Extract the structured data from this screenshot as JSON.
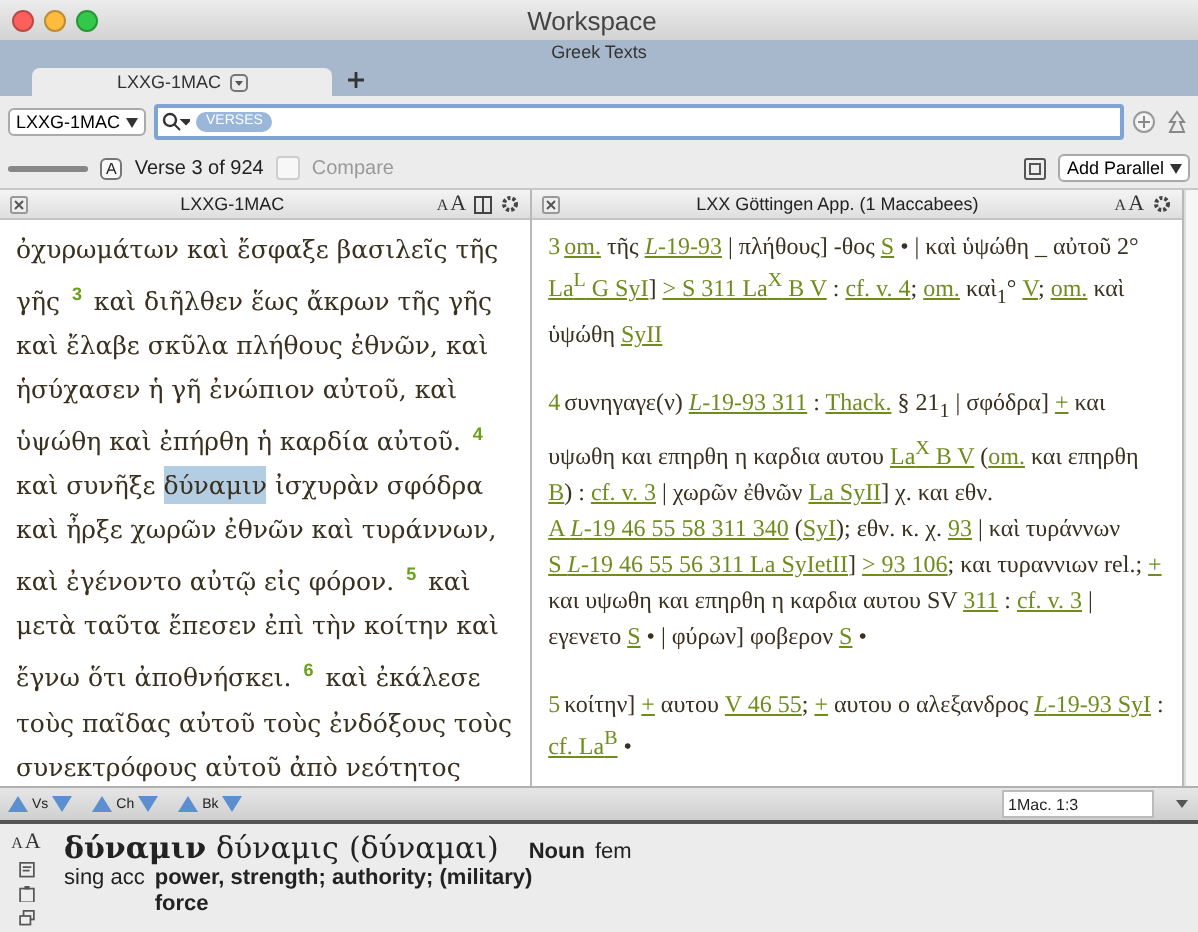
{
  "window": {
    "title": "Workspace",
    "subtitle": "Greek Texts"
  },
  "tabs": [
    {
      "label": "LXXG-1MAC",
      "selected": true
    }
  ],
  "toolbar": {
    "font_slider": {
      "level": 1,
      "knob": "A"
    },
    "module": "LXXG-1MAC",
    "search_chip": "VERSES",
    "verse_status": "Verse 3 of 924",
    "compare": {
      "label": "Compare",
      "checked": false,
      "disabled": true
    },
    "add_parallel": "Add Parallel"
  },
  "left_pane": {
    "title": "LXXG-1MAC",
    "font_buttons": [
      "A",
      "A"
    ],
    "text": [
      {
        "kind": "text",
        "t": "ὀχυρωμάτων καὶ ἔσφαξε βασιλεῖς τῆς γῆς "
      },
      {
        "kind": "verse",
        "t": "3"
      },
      {
        "kind": "text",
        "t": " καὶ διῆλθεν ἕως ἄκρων τῆς γῆς καὶ ἔλαβε σκῦλα πλήθους ἐθνῶν, καὶ ἡσύχασεν ἡ γῆ ἐνώπιον αὐτοῦ, καὶ ὑψώθη καὶ ἐπήρθη ἡ καρδία αὐτοῦ. "
      },
      {
        "kind": "verse",
        "t": "4"
      },
      {
        "kind": "text",
        "t": " καὶ συνῆξε "
      },
      {
        "kind": "highlight",
        "t": "δύναμιν"
      },
      {
        "kind": "text",
        "t": " ἰσχυρὰν σφόδρα καὶ ἦρξε χωρῶν ἐθνῶν καὶ τυράννων, καὶ ἐγένοντο αὐτῷ εἰς φόρον. "
      },
      {
        "kind": "verse",
        "t": "5"
      },
      {
        "kind": "text",
        "t": " καὶ μετὰ ταῦτα ἔπεσεν ἐπὶ τὴν κοίτην καὶ ἔγνω ὅτι ἀποθνήσκει. "
      },
      {
        "kind": "verse",
        "t": "6"
      },
      {
        "kind": "text",
        "t": " καὶ ἐκάλεσε τοὺς παῖδας αὐτοῦ τοὺς ἐνδόξους τοὺς συνεκτρόφους αὐτοῦ ἀπὸ νεότητος"
      }
    ]
  },
  "right_pane": {
    "title": "LXX Göttingen App. (1 Maccabees)",
    "font_buttons": [
      "A",
      "A"
    ],
    "paragraphs": [
      [
        {
          "kind": "verse",
          "t": "3"
        },
        {
          "kind": "link",
          "t": "om."
        },
        {
          "kind": "text",
          "t": " τῆς "
        },
        {
          "kind": "link",
          "t": "*L*-19-93"
        },
        {
          "kind": "text",
          "t": " | πλήθους] -θος "
        },
        {
          "kind": "link",
          "t": "S"
        },
        {
          "kind": "text",
          "t": " • | καὶ ὑψώθη _ αὐτοῦ 2° "
        },
        {
          "kind": "link",
          "t": "La$^{L}$ G SyI"
        },
        {
          "kind": "text",
          "t": "] "
        },
        {
          "kind": "link",
          "t": "> S 311 La$^{X}$ B V"
        },
        {
          "kind": "text",
          "t": " : "
        },
        {
          "kind": "link",
          "t": "cf. v. 4"
        },
        {
          "kind": "text",
          "t": "; "
        },
        {
          "kind": "link",
          "t": "om."
        },
        {
          "kind": "text",
          "t": " καὶ$_{1}$° "
        },
        {
          "kind": "link",
          "t": "V"
        },
        {
          "kind": "text",
          "t": "; "
        },
        {
          "kind": "link",
          "t": "om."
        },
        {
          "kind": "text",
          "t": " καὶ ὑψώθη "
        },
        {
          "kind": "link",
          "t": "SyII"
        }
      ],
      [
        {
          "kind": "verse",
          "t": "4"
        },
        {
          "kind": "text",
          "t": "συνηγαγε(ν) "
        },
        {
          "kind": "link",
          "t": "*L*-19-93 311"
        },
        {
          "kind": "text",
          "t": " : "
        },
        {
          "kind": "link",
          "t": "Thack."
        },
        {
          "kind": "text",
          "t": " § 21$_{1}$ | σφόδρα] "
        },
        {
          "kind": "link",
          "t": "+"
        },
        {
          "kind": "text",
          "t": " και υψωθη και επηρθη η καρδια αυτου "
        },
        {
          "kind": "link",
          "t": "La$^{X}$ B V"
        },
        {
          "kind": "text",
          "t": " ("
        },
        {
          "kind": "link",
          "t": "om."
        },
        {
          "kind": "text",
          "t": " και επηρθη "
        },
        {
          "kind": "link",
          "t": "B"
        },
        {
          "kind": "text",
          "t": ") : "
        },
        {
          "kind": "link",
          "t": "cf. v. 3"
        },
        {
          "kind": "text",
          "t": " | χωρῶν ἐθνῶν "
        },
        {
          "kind": "link",
          "t": "La SyII"
        },
        {
          "kind": "text",
          "t": "] χ. και εθν. "
        },
        {
          "kind": "link",
          "t": "A *L*-19 46 55 58 311 340"
        },
        {
          "kind": "text",
          "t": " ("
        },
        {
          "kind": "link",
          "t": "SyI"
        },
        {
          "kind": "text",
          "t": "); εθν. κ. χ. "
        },
        {
          "kind": "link",
          "t": "93"
        },
        {
          "kind": "text",
          "t": " | καὶ τυράννων "
        },
        {
          "kind": "link",
          "t": "S *L*-19 46 55 56 311 La SyIetII"
        },
        {
          "kind": "text",
          "t": "] "
        },
        {
          "kind": "link",
          "t": "> 93 106"
        },
        {
          "kind": "text",
          "t": "; και τυραννιων rel.; "
        },
        {
          "kind": "link",
          "t": "+"
        },
        {
          "kind": "text",
          "t": " και υψωθη και επηρθη η καρδια αυτου SV "
        },
        {
          "kind": "link",
          "t": "311"
        },
        {
          "kind": "text",
          "t": " : "
        },
        {
          "kind": "link",
          "t": "cf. v. 3"
        },
        {
          "kind": "text",
          "t": " | εγενετο "
        },
        {
          "kind": "link",
          "t": "S"
        },
        {
          "kind": "text",
          "t": " • | φύρων] φοβερον "
        },
        {
          "kind": "link",
          "t": "S"
        },
        {
          "kind": "text",
          "t": " •"
        }
      ],
      [
        {
          "kind": "verse",
          "t": "5"
        },
        {
          "kind": "text",
          "t": "κοίτην] "
        },
        {
          "kind": "link",
          "t": "+"
        },
        {
          "kind": "text",
          "t": " αυτου "
        },
        {
          "kind": "link",
          "t": "V 46 55"
        },
        {
          "kind": "text",
          "t": "; "
        },
        {
          "kind": "link",
          "t": "+"
        },
        {
          "kind": "text",
          "t": " αυτου ο αλεξανδρος "
        },
        {
          "kind": "link",
          "t": "*L*-19-93 SyI"
        },
        {
          "kind": "text",
          "t": " : "
        },
        {
          "kind": "link",
          "t": "cf. La$^{B}$"
        },
        {
          "kind": "text",
          "t": " •"
        }
      ]
    ]
  },
  "nav": [
    {
      "label": "Vs"
    },
    {
      "label": "Ch"
    },
    {
      "label": "Bk"
    }
  ],
  "reference": "1Mac. 1:3",
  "info": {
    "font_buttons": [
      "A",
      "A"
    ],
    "word": "δύναμιν",
    "lemma": "δύναμις",
    "root": "(δύναμαι)",
    "pos": "Noun",
    "gender": "fem",
    "parsing": "sing acc",
    "gloss": "power, strength; authority; (military) force"
  }
}
